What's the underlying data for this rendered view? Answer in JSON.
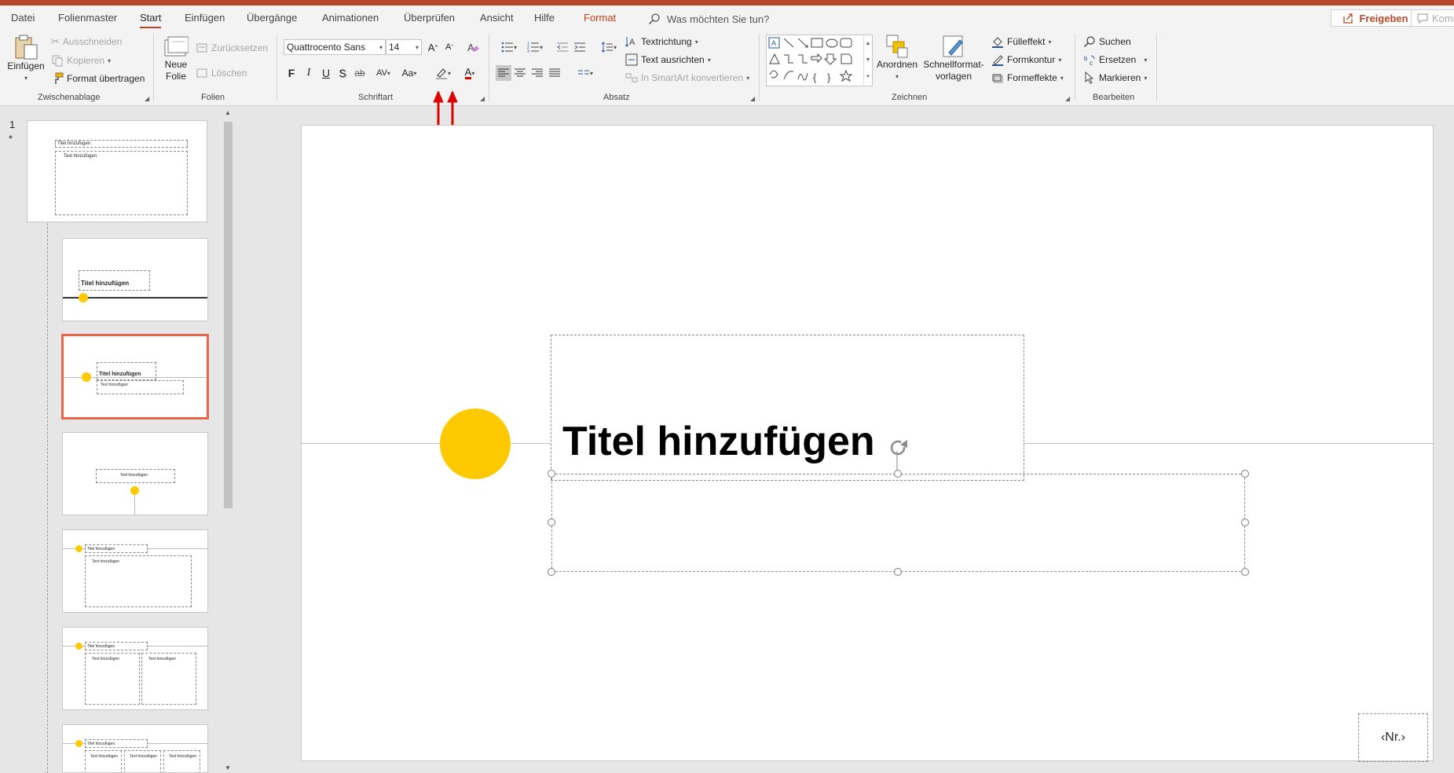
{
  "menu": {
    "tabs": [
      "Datei",
      "Folienmaster",
      "Start",
      "Einfügen",
      "Übergänge",
      "Animationen",
      "Überprüfen",
      "Ansicht",
      "Hilfe",
      "Format"
    ],
    "active_tab": "Start",
    "tell_me": "Was möchten Sie tun?",
    "share": "Freigeben",
    "comments": "Komm"
  },
  "ribbon": {
    "clipboard": {
      "paste": "Einfügen",
      "cut": "Ausschneiden",
      "copy": "Kopieren",
      "format_painter": "Format übertragen",
      "label": "Zwischenablage"
    },
    "slides": {
      "new_slide_line1": "Neue",
      "new_slide_line2": "Folie",
      "reset": "Zurücksetzen",
      "delete": "Löschen",
      "label": "Folien"
    },
    "font": {
      "font_name": "Quattrocento Sans",
      "font_size": "14",
      "label": "Schriftart",
      "bold": "F",
      "italic": "I",
      "underline": "U",
      "shadow": "S",
      "strike": "ab",
      "spacing": "AV",
      "case": "Aa",
      "grow": "A",
      "shrink": "A",
      "font_color_letter": "A"
    },
    "paragraph": {
      "text_direction": "Textrichtung",
      "align_text": "Text ausrichten",
      "smartart": "In SmartArt konvertieren",
      "label": "Absatz"
    },
    "drawing": {
      "arrange": "Anordnen",
      "quick_styles_line1": "Schnellformat-",
      "quick_styles_line2": "vorlagen",
      "fill": "Fülleffekt",
      "outline": "Formkontur",
      "effects": "Formeffekte",
      "label": "Zeichnen"
    },
    "editing": {
      "find": "Suchen",
      "replace": "Ersetzen",
      "select": "Markieren",
      "label": "Bearbeiten"
    }
  },
  "thumbnails": {
    "slide_number": "1",
    "star": "*",
    "title": "Titel hinzufügen",
    "text": "Text hinzufügen"
  },
  "slide": {
    "title": "Titel hinzufügen",
    "page_number": "‹Nr.›"
  },
  "colors": {
    "accent": "#b7472a",
    "selection": "#e8674a",
    "circle": "#ffc900",
    "annotation_arrow": "#e00000"
  }
}
